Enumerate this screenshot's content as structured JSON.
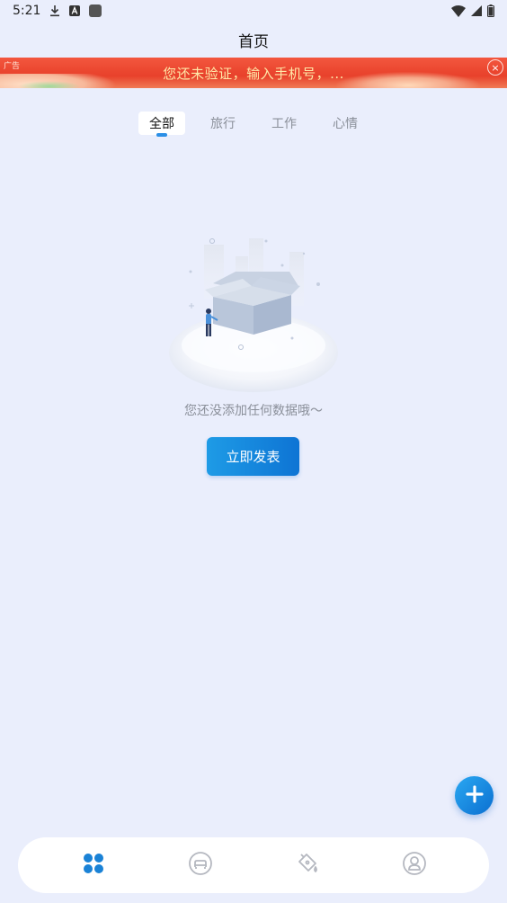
{
  "status_bar": {
    "time": "5:21",
    "icons": [
      "download-icon",
      "a-badge-icon",
      "square-app-icon",
      "wifi-icon",
      "signal-icon",
      "battery-icon"
    ]
  },
  "header": {
    "title": "首页"
  },
  "ad": {
    "tag": "广告",
    "text": "您还未验证，输入手机号，...",
    "close_icon": "close-icon",
    "colors": {
      "background": "#e8412b",
      "text": "#ffe8a8"
    }
  },
  "tabs": [
    {
      "label": "全部",
      "active": true
    },
    {
      "label": "旅行",
      "active": false
    },
    {
      "label": "工作",
      "active": false
    },
    {
      "label": "心情",
      "active": false
    }
  ],
  "empty_state": {
    "illustration": "empty-box-illustration",
    "message": "您还没添加任何数据哦～",
    "button_label": "立即发表"
  },
  "fab": {
    "icon": "plus-icon"
  },
  "bottom_nav": {
    "items": [
      {
        "icon": "grid-dots-icon",
        "active": true
      },
      {
        "icon": "desk-icon",
        "active": false
      },
      {
        "icon": "paint-bucket-icon",
        "active": false
      },
      {
        "icon": "user-circle-icon",
        "active": false
      }
    ]
  },
  "colors": {
    "accent": "#0e74d4",
    "background": "#eaeefc",
    "nav_inactive": "#b5b8c0"
  }
}
